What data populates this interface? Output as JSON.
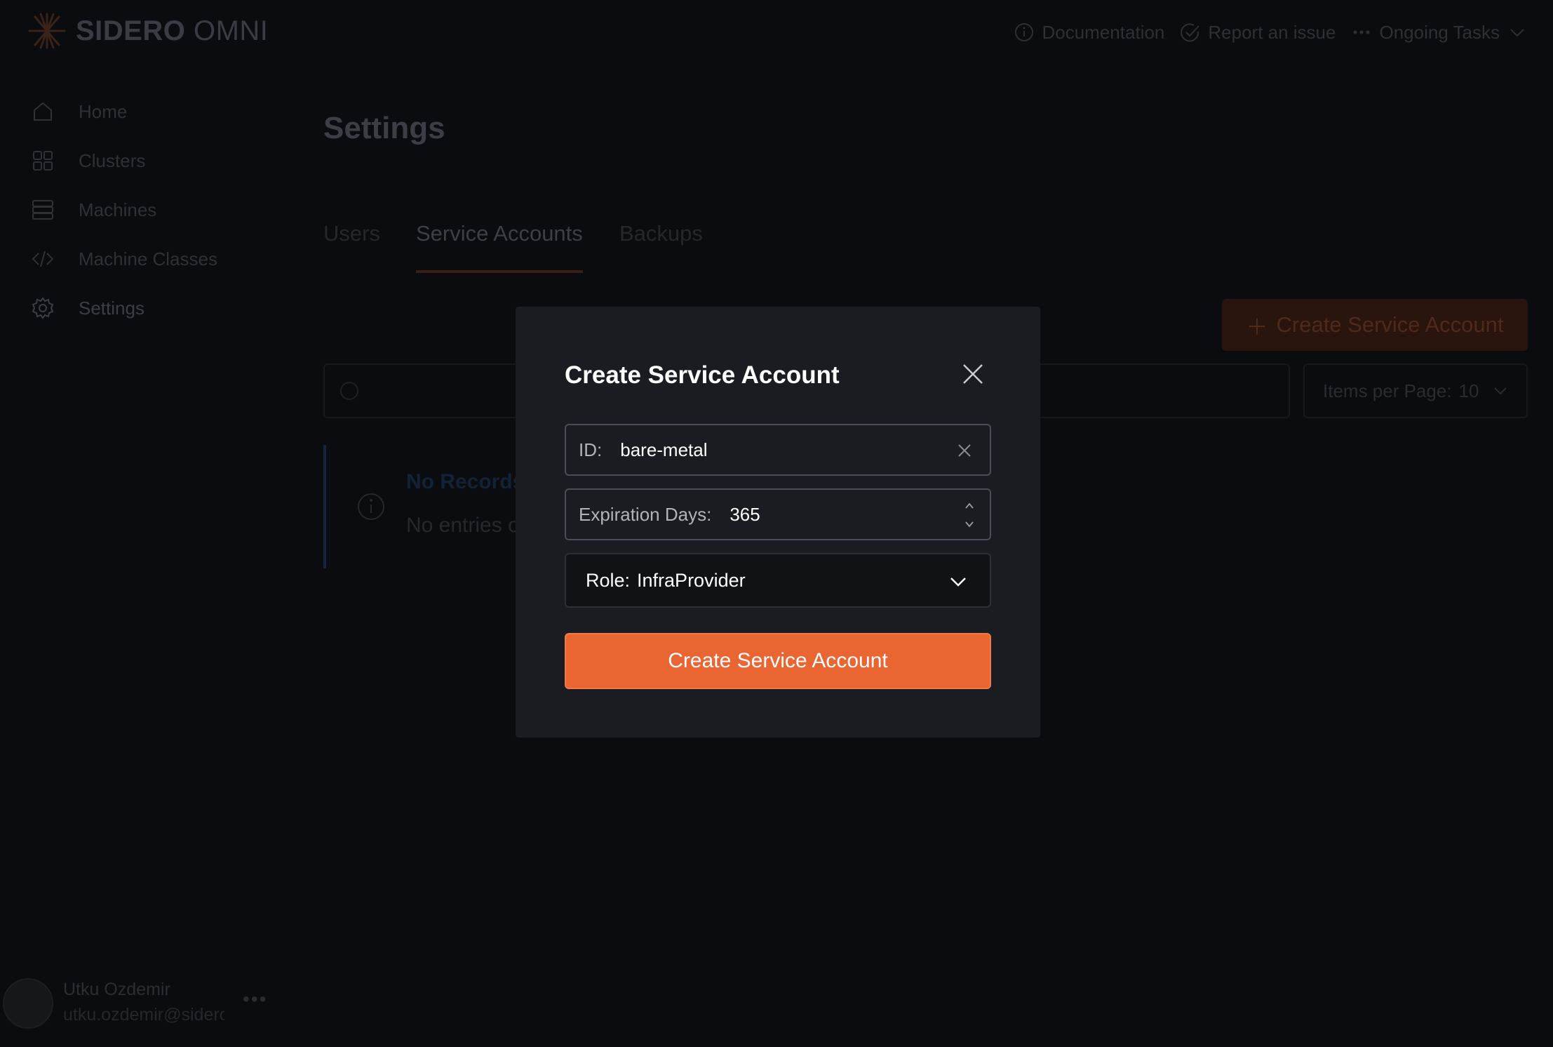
{
  "brand": {
    "name_bold": "SIDERO",
    "name_light": "OMNI"
  },
  "header": {
    "links": [
      {
        "label": "Documentation",
        "icon": "info-icon"
      },
      {
        "label": "Report an issue",
        "icon": "check-circle-icon"
      },
      {
        "label": "Ongoing Tasks",
        "icon": "ellipsis-icon"
      }
    ]
  },
  "sidebar": {
    "items": [
      {
        "label": "Home",
        "icon": "home-icon"
      },
      {
        "label": "Clusters",
        "icon": "grid-icon"
      },
      {
        "label": "Machines",
        "icon": "server-icon"
      },
      {
        "label": "Machine Classes",
        "icon": "code-icon"
      },
      {
        "label": "Settings",
        "icon": "gear-icon"
      }
    ],
    "user": {
      "name": "Utku Ozdemir",
      "email": "utku.ozdemir@sidero",
      "menu": "•••"
    }
  },
  "main": {
    "title": "Settings",
    "tabs": [
      {
        "label": "Users"
      },
      {
        "label": "Service Accounts",
        "active": true
      },
      {
        "label": "Backups"
      }
    ],
    "create_button": "Create Service Account",
    "per_page": {
      "label": "Items per Page:",
      "value": "10"
    },
    "alert": {
      "title": "No Records",
      "text": "No entries of the requested resource type are found on the server."
    }
  },
  "modal": {
    "title": "Create Service Account",
    "id_field": {
      "label": "ID:",
      "value": "bare-metal"
    },
    "expiration_field": {
      "label": "Expiration Days:",
      "value": "365"
    },
    "role_select": {
      "label": "Role:",
      "value": "InfraProvider"
    },
    "submit_label": "Create Service Account"
  },
  "colors": {
    "accent": "#e96633",
    "modal_bg": "#1a1c21",
    "page_bg": "#0b0c10"
  }
}
